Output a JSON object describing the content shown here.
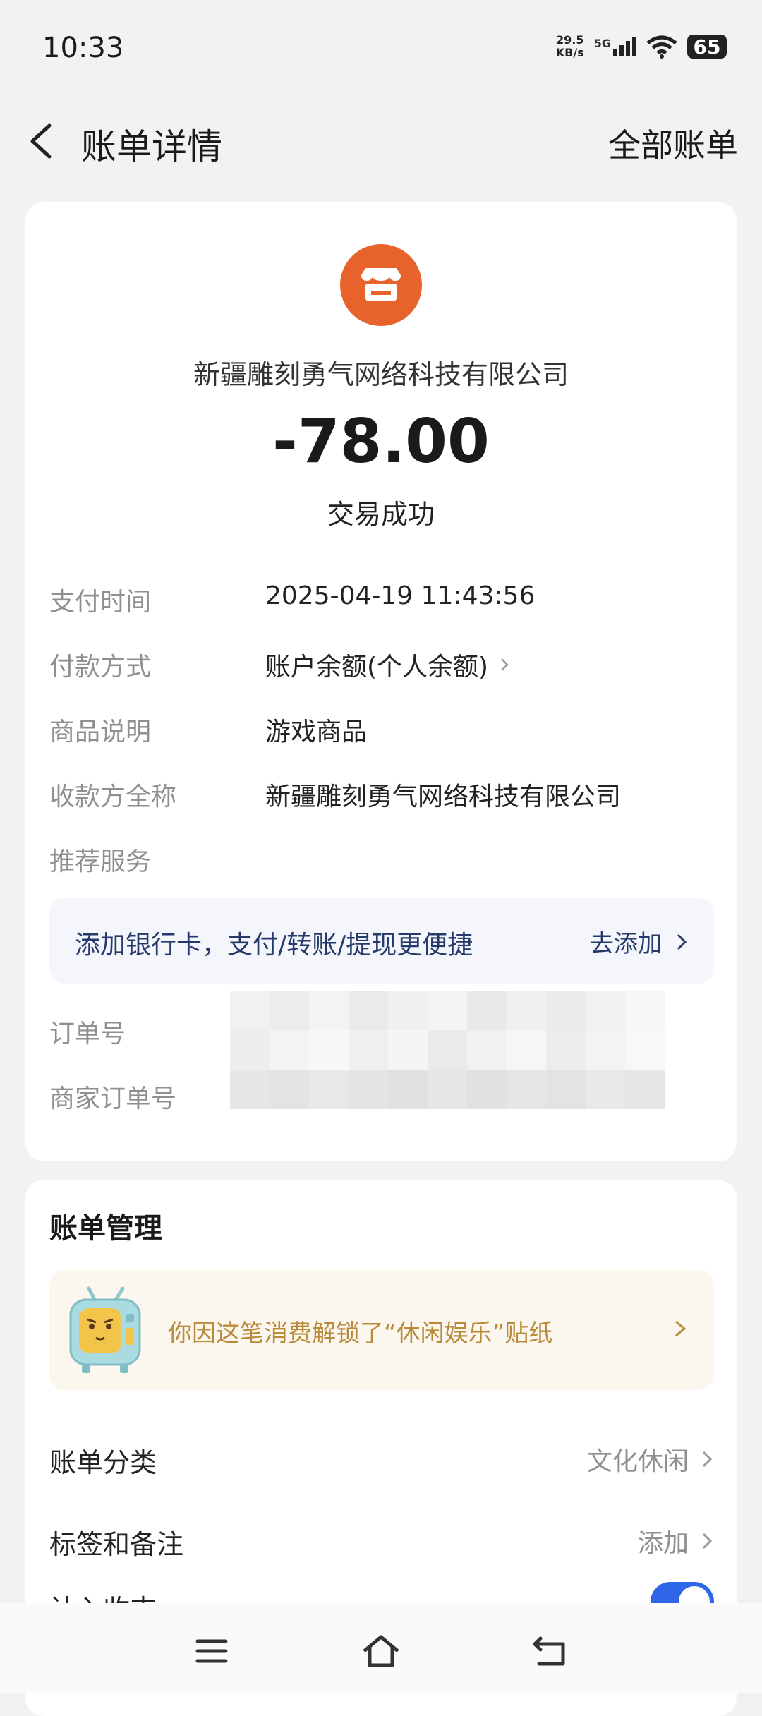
{
  "status": {
    "time": "10:33",
    "speed_value": "29.5",
    "speed_unit": "KB/s",
    "network": "5G",
    "battery": "65"
  },
  "header": {
    "title": "账单详情",
    "right_link": "全部账单"
  },
  "transaction": {
    "merchant": "新疆雕刻勇气网络科技有限公司",
    "amount": "-78.00",
    "status": "交易成功",
    "icon": "store-icon",
    "icon_color": "#e8622c"
  },
  "details": {
    "pay_time_label": "支付时间",
    "pay_time_value": "2025-04-19 11:43:56",
    "pay_method_label": "付款方式",
    "pay_method_value": "账户余额(个人余额)",
    "product_label": "商品说明",
    "product_value": "游戏商品",
    "payee_label": "收款方全称",
    "payee_value": "新疆雕刻勇气网络科技有限公司",
    "recommend_label": "推荐服务",
    "order_label": "订单号",
    "merchant_order_label": "商家订单号"
  },
  "promo": {
    "text": "添加银行卡，支付/转账/提现更便捷",
    "action": "去添加"
  },
  "management": {
    "title": "账单管理",
    "sticker_text": "你因这笔消费解锁了“休闲娱乐”贴纸",
    "category_label": "账单分类",
    "category_value": "文化休闲",
    "tags_label": "标签和备注",
    "tags_value": "添加",
    "cut_label": "计入收支"
  },
  "colors": {
    "accent_blue": "#2f66e8",
    "promo_text": "#233a6a",
    "sticker_text": "#b98a3a"
  }
}
